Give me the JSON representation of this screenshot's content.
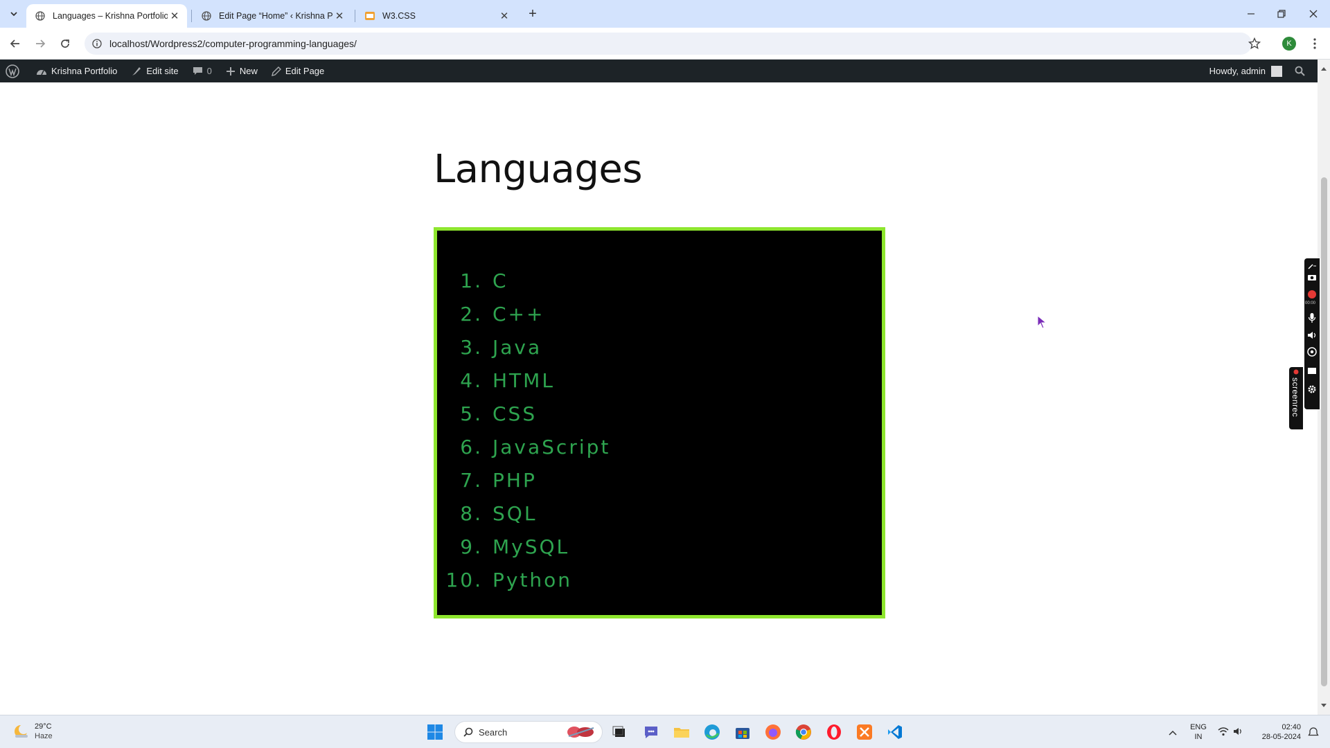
{
  "browser": {
    "tabs": [
      {
        "title": "Languages – Krishna Portfolio",
        "active": true
      },
      {
        "title": "Edit Page “Home” ‹ Krishna Por",
        "active": false
      },
      {
        "title": "W3.CSS",
        "active": false
      }
    ],
    "url": "localhost/Wordpress2/computer-programming-languages/",
    "profile_initial": "K"
  },
  "admin_bar": {
    "site_name": "Krishna Portfolio",
    "edit_site": "Edit site",
    "comments_count": "0",
    "new_label": "New",
    "edit_page": "Edit Page",
    "greeting": "Howdy, admin"
  },
  "page": {
    "title": "Languages",
    "languages": [
      {
        "num": "1.",
        "name": "C"
      },
      {
        "num": "2.",
        "name": "C++"
      },
      {
        "num": "3.",
        "name": "Java"
      },
      {
        "num": "4.",
        "name": "HTML"
      },
      {
        "num": "5.",
        "name": "CSS"
      },
      {
        "num": "6.",
        "name": "JavaScript"
      },
      {
        "num": "7.",
        "name": "PHP"
      },
      {
        "num": "8.",
        "name": "SQL"
      },
      {
        "num": "9.",
        "name": "MySQL"
      },
      {
        "num": "10.",
        "name": "Python"
      }
    ],
    "colors": {
      "box_border": "#8ee62e",
      "list_text": "#2ea44f",
      "box_bg": "#000000"
    }
  },
  "recorder": {
    "label": "screenrec",
    "timer": "00:00"
  },
  "taskbar": {
    "weather_temp": "29°C",
    "weather_desc": "Haze",
    "search_placeholder": "Search",
    "lang_top": "ENG",
    "lang_bottom": "IN",
    "time": "02:40",
    "date": "28-05-2024"
  }
}
